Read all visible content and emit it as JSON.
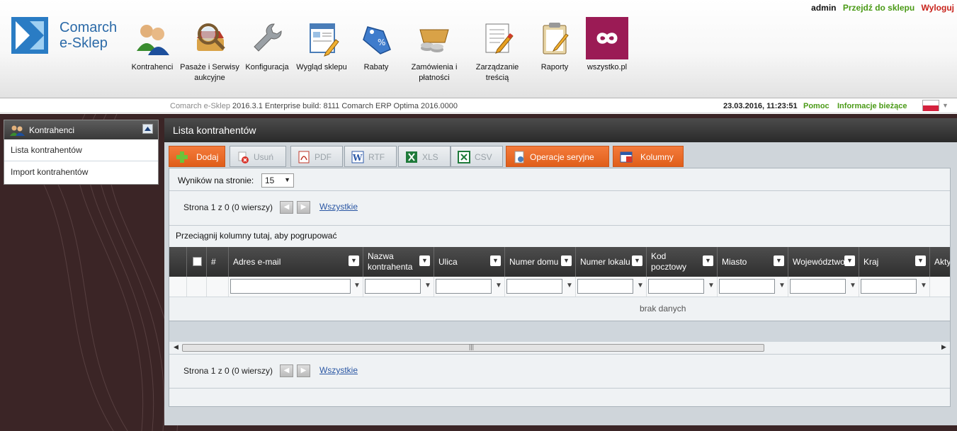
{
  "header": {
    "logo": {
      "line1": "Comarch",
      "line2": "e-Sklep"
    },
    "user": "admin",
    "goto_shop": "Przejdź do sklepu",
    "logout": "Wyloguj",
    "nav": [
      {
        "label1": "Kontrahenci",
        "label2": "",
        "icon": "users-icon"
      },
      {
        "label1": "Pasaże i Serwisy",
        "label2": "aukcyjne",
        "icon": "magnifier-basket-icon"
      },
      {
        "label1": "Konfiguracja",
        "label2": "",
        "icon": "wrench-icon"
      },
      {
        "label1": "Wygląd sklepu",
        "label2": "",
        "icon": "layout-pencil-icon"
      },
      {
        "label1": "Rabaty",
        "label2": "",
        "icon": "price-tag-icon"
      },
      {
        "label1": "Zamówienia i",
        "label2": "płatności",
        "icon": "cart-coins-icon"
      },
      {
        "label1": "Zarządzanie",
        "label2": "treścią",
        "icon": "document-pencil-icon"
      },
      {
        "label1": "Raporty",
        "label2": "",
        "icon": "clipboard-icon"
      },
      {
        "label1": "wszystko.pl",
        "label2": "",
        "icon": "infinity-icon"
      }
    ]
  },
  "infobar": {
    "product": "Comarch e-Sklep",
    "version": "2016.3.1 Enterprise build: 8111 Comarch ERP Optima 2016.0000",
    "datetime": "23.03.2016, 11:23:51",
    "help": "Pomoc",
    "info": "Informacje bieżące"
  },
  "sidebar": {
    "title": "Kontrahenci",
    "items": [
      "Lista kontrahentów",
      "Import kontrahentów"
    ]
  },
  "main": {
    "title": "Lista kontrahentów",
    "toolbar": {
      "add": "Dodaj",
      "delete": "Usuń",
      "pdf": "PDF",
      "rtf": "RTF",
      "xls": "XLS",
      "csv": "CSV",
      "bulk_ops": "Operacje seryjne",
      "columns": "Kolumny"
    },
    "per_page_label": "Wyników na stronie:",
    "per_page_value": "15",
    "pager_top": {
      "text": "Strona 1 z 0 (0 wierszy)",
      "all": "Wszystkie"
    },
    "pager_bottom": {
      "text": "Strona 1 z 0 (0 wierszy)",
      "all": "Wszystkie"
    },
    "group_hint": "Przeciągnij kolumny tutaj, aby pogrupować",
    "hash": "#",
    "columns": [
      {
        "l1": "Adres e-mail",
        "l2": ""
      },
      {
        "l1": "Nazwa",
        "l2": "kontrahenta"
      },
      {
        "l1": "Ulica",
        "l2": ""
      },
      {
        "l1": "Numer domu",
        "l2": ""
      },
      {
        "l1": "Numer lokalu",
        "l2": ""
      },
      {
        "l1": "Kod",
        "l2": "pocztowy"
      },
      {
        "l1": "Miasto",
        "l2": ""
      },
      {
        "l1": "Województwo",
        "l2": ""
      },
      {
        "l1": "Kraj",
        "l2": ""
      },
      {
        "l1": "Akty",
        "l2": ""
      }
    ],
    "no_data": "brak danych"
  },
  "colors": {
    "accent_orange": "#e8651f",
    "link_green": "#4a9a16",
    "link_red": "#c8231b",
    "dark_bg": "#3b2526"
  }
}
